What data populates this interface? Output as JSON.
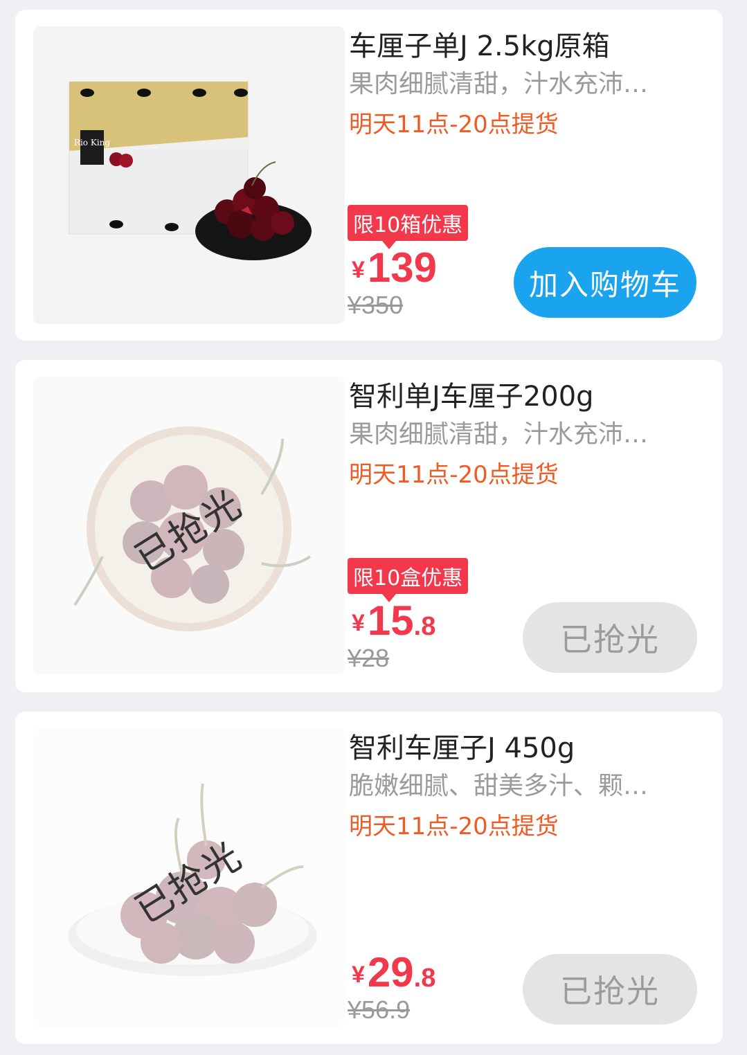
{
  "products": [
    {
      "title": "车厘子单J 2.5kg原箱",
      "description": "果肉细腻清甜，汁水充沛…",
      "pickup_time": "明天11点-20点提货",
      "limit_badge": "限10箱优惠",
      "currency": "¥",
      "price_int": "139",
      "price_dec": "",
      "original_price": "¥350",
      "box_logo": "Rio King",
      "action_label": "加入购物车"
    },
    {
      "title": "智利单J车厘子200g",
      "description": "果肉细腻清甜，汁水充沛…",
      "pickup_time": "明天11点-20点提货",
      "limit_badge": "限10盒优惠",
      "currency": "¥",
      "price_int": "15",
      "price_dec": ".8",
      "original_price": "¥28",
      "soldout_stamp": "已抢光",
      "action_label": "已抢光"
    },
    {
      "title": "智利车厘子J 450g",
      "description": "脆嫩细腻、甜美多汁、颗…",
      "pickup_time": "明天11点-20点提货",
      "currency": "¥",
      "price_int": "29",
      "price_dec": ".8",
      "original_price": "¥56.9",
      "soldout_stamp": "已抢光",
      "action_label": "已抢光"
    }
  ],
  "colors": {
    "accent_red": "#f2384a",
    "pickup_orange": "#f05a24",
    "cart_blue": "#1aa4ef",
    "soldout_gray": "#e4e4e4"
  },
  "icons": [
    "cherry-box-image",
    "cherry-bowl-image",
    "cherry-plate-image"
  ]
}
